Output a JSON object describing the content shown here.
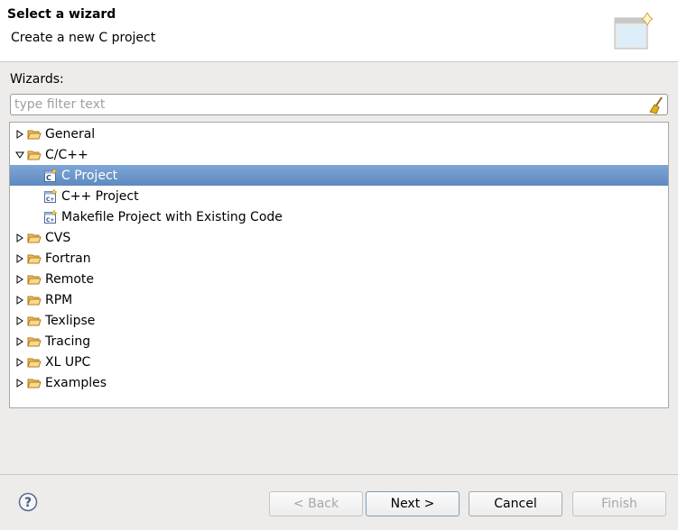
{
  "header": {
    "title": "Select a wizard",
    "subtitle": "Create a new C project"
  },
  "wizards_label": "Wizards:",
  "filter": {
    "placeholder": "type filter text",
    "value": ""
  },
  "tree": [
    {
      "label": "General",
      "level": 0,
      "expanded": false,
      "icon": "folder-icon"
    },
    {
      "label": "C/C++",
      "level": 0,
      "expanded": true,
      "icon": "folder-icon"
    },
    {
      "label": "C Project",
      "level": 1,
      "icon": "c-project-icon",
      "selected": true
    },
    {
      "label": "C++ Project",
      "level": 1,
      "icon": "cpp-project-icon"
    },
    {
      "label": "Makefile Project with Existing Code",
      "level": 1,
      "icon": "cpp-project-icon"
    },
    {
      "label": "CVS",
      "level": 0,
      "expanded": false,
      "icon": "folder-icon"
    },
    {
      "label": "Fortran",
      "level": 0,
      "expanded": false,
      "icon": "folder-icon"
    },
    {
      "label": "Remote",
      "level": 0,
      "expanded": false,
      "icon": "folder-icon"
    },
    {
      "label": "RPM",
      "level": 0,
      "expanded": false,
      "icon": "folder-icon"
    },
    {
      "label": "Texlipse",
      "level": 0,
      "expanded": false,
      "icon": "folder-icon"
    },
    {
      "label": "Tracing",
      "level": 0,
      "expanded": false,
      "icon": "folder-icon"
    },
    {
      "label": "XL UPC",
      "level": 0,
      "expanded": false,
      "icon": "folder-icon"
    },
    {
      "label": "Examples",
      "level": 0,
      "expanded": false,
      "icon": "folder-icon"
    }
  ],
  "buttons": {
    "back": "< Back",
    "next": "Next >",
    "cancel": "Cancel",
    "finish": "Finish"
  },
  "colors": {
    "selection": "#6b93c8",
    "background": "#edeceb"
  }
}
